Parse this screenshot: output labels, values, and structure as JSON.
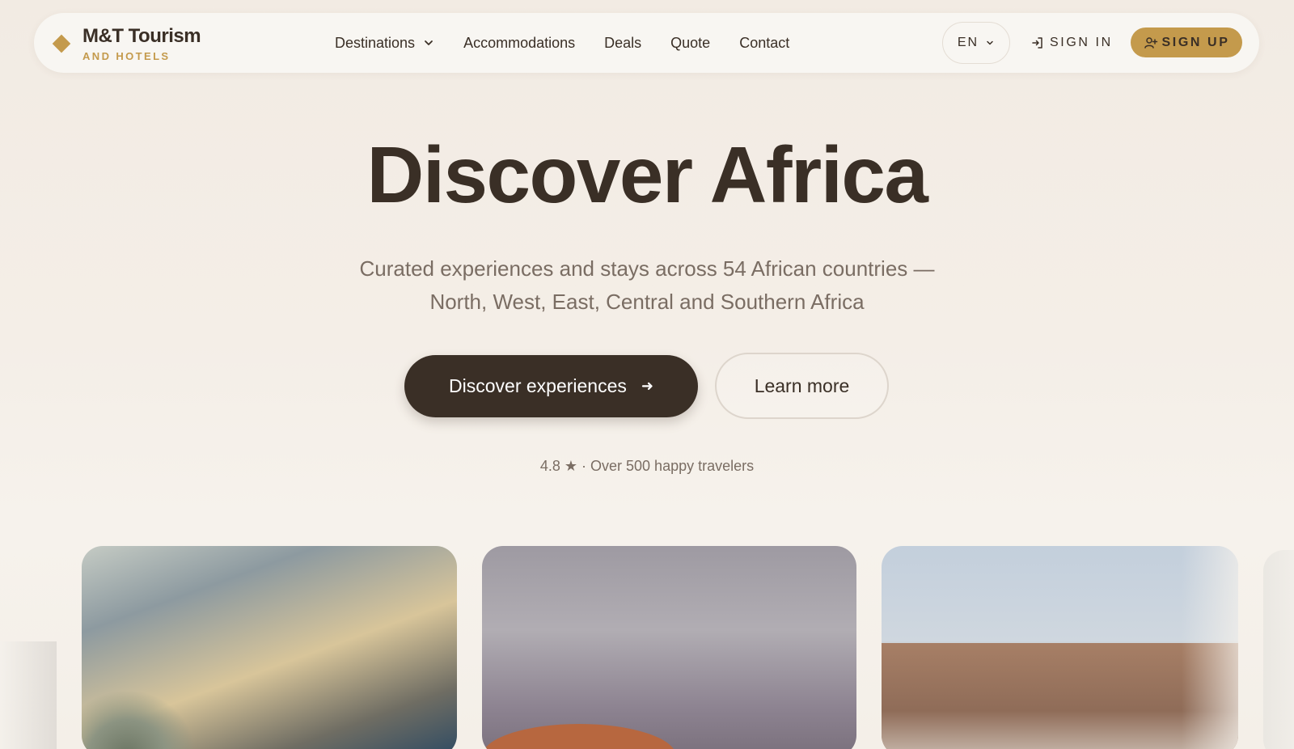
{
  "brand": {
    "name": "M&T Tourism",
    "tagline": "AND HOTELS"
  },
  "nav": {
    "links": [
      {
        "label": "Destinations",
        "has_dropdown": true
      },
      {
        "label": "Accommodations"
      },
      {
        "label": "Deals"
      },
      {
        "label": "Quote"
      },
      {
        "label": "Contact"
      }
    ],
    "language": "EN",
    "sign_in": "SIGN IN",
    "sign_up": "SIGN UP"
  },
  "hero": {
    "title": "Discover Africa",
    "subtitle_line1": "Curated experiences and stays across 54 African countries —",
    "subtitle_line2": "North, West, East, Central and Southern Africa",
    "primary_cta": "Discover experiences",
    "secondary_cta": "Learn more",
    "rating": "4.8 ★ · Over 500 happy travelers"
  },
  "colors": {
    "accent": "#c49a4c",
    "dark": "#3a2f26",
    "background": "#f4eee7",
    "muted_text": "#7a6d63"
  },
  "icons": {
    "logo": "diamond-icon",
    "dropdown": "chevron-down-icon",
    "sign_in": "sign-in-icon",
    "sign_up": "user-plus-icon",
    "cta_arrow": "arrow-right-icon"
  }
}
